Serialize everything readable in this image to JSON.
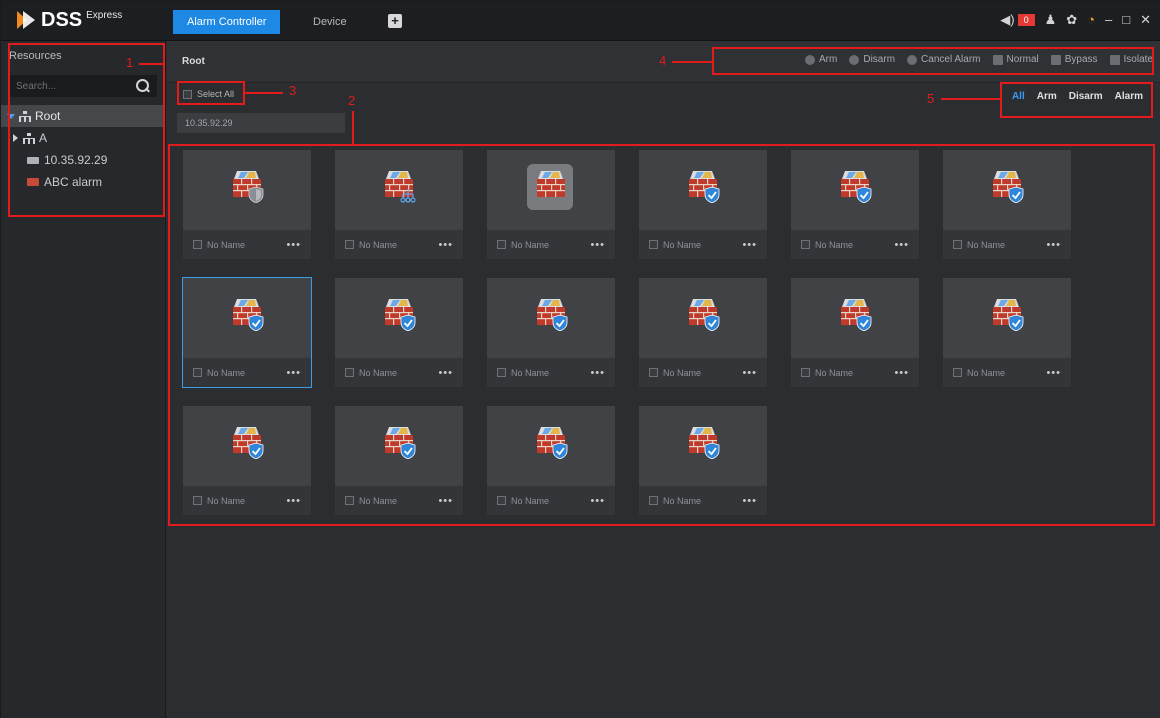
{
  "app": {
    "logo": "DSS",
    "logo_sub": "Express"
  },
  "tabs": [
    {
      "label": "Alarm Controller",
      "active": true
    },
    {
      "label": "Device",
      "active": false
    }
  ],
  "system": {
    "alarm_count": "0"
  },
  "sidebar": {
    "title": "Resources",
    "search_placeholder": "Search...",
    "tree": {
      "root": "Root",
      "children": [
        {
          "label": "A",
          "icon": "org-icon"
        },
        {
          "label": "10.35.92.29",
          "icon": "device-icon"
        },
        {
          "label": "ABC  alarm",
          "icon": "alarm-device-icon"
        }
      ]
    }
  },
  "main": {
    "breadcrumb": "Root",
    "select_all": "Select All",
    "device_chip": "10.35.92.29",
    "actions": [
      "Arm",
      "Disarm",
      "Cancel Alarm",
      "Normal",
      "Bypass",
      "Isolate"
    ],
    "filters": [
      {
        "label": "All",
        "active": true
      },
      {
        "label": "Arm",
        "active": false
      },
      {
        "label": "Disarm",
        "active": false
      },
      {
        "label": "Alarm",
        "active": false
      }
    ],
    "cards": [
      {
        "name": "No Name",
        "state": "shield-gray"
      },
      {
        "name": "No Name",
        "state": "network"
      },
      {
        "name": "No Name",
        "state": "highlighted"
      },
      {
        "name": "No Name",
        "state": "armed"
      },
      {
        "name": "No Name",
        "state": "armed"
      },
      {
        "name": "No Name",
        "state": "armed"
      },
      {
        "name": "No Name",
        "state": "armed",
        "selected": true
      },
      {
        "name": "No Name",
        "state": "armed"
      },
      {
        "name": "No Name",
        "state": "armed"
      },
      {
        "name": "No Name",
        "state": "armed"
      },
      {
        "name": "No Name",
        "state": "armed"
      },
      {
        "name": "No Name",
        "state": "armed"
      },
      {
        "name": "No Name",
        "state": "armed"
      },
      {
        "name": "No Name",
        "state": "armed"
      },
      {
        "name": "No Name",
        "state": "armed"
      },
      {
        "name": "No Name",
        "state": "armed"
      }
    ]
  },
  "annotations": [
    "1",
    "2",
    "3",
    "4",
    "5"
  ],
  "colors": {
    "accent": "#1e88e5",
    "annotation": "#e21c1c",
    "alarm_badge": "#e53935"
  }
}
